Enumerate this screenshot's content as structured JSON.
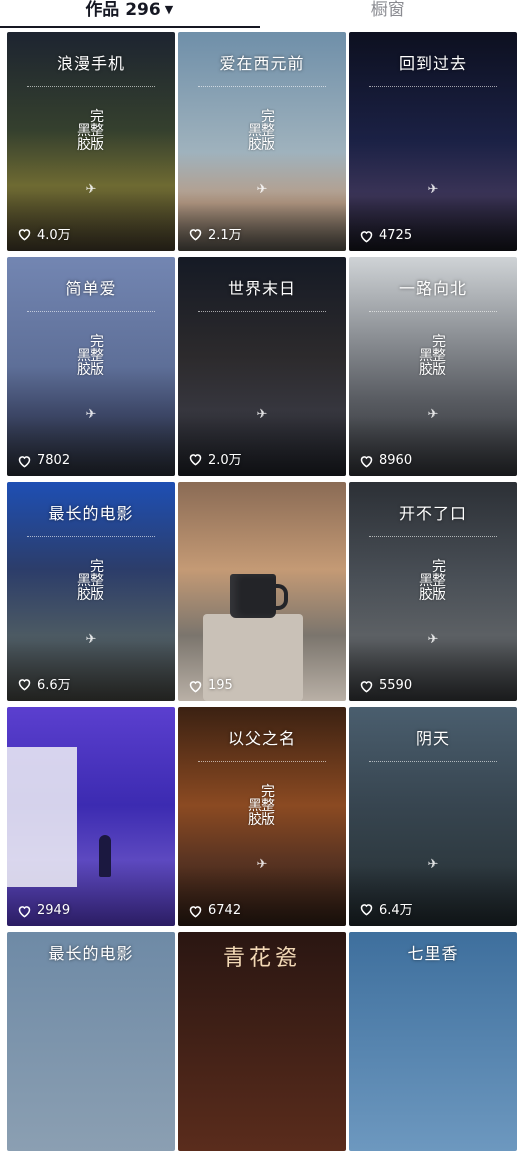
{
  "tabs": {
    "works_label": "作品 296",
    "favorites_label": "橱窗"
  },
  "posts": [
    {
      "title": "浪漫手机",
      "likes": "4.0万",
      "badge": true
    },
    {
      "title": "爱在西元前",
      "likes": "2.1万",
      "badge": true
    },
    {
      "title": "回到过去",
      "likes": "4725",
      "badge": false
    },
    {
      "title": "简单爱",
      "likes": "7802",
      "badge": true
    },
    {
      "title": "世界末日",
      "likes": "2.0万",
      "badge": false
    },
    {
      "title": "一路向北",
      "likes": "8960",
      "badge": true
    },
    {
      "title": "最长的电影",
      "likes": "6.6万",
      "badge": true
    },
    {
      "title": "",
      "likes": "195",
      "badge": false
    },
    {
      "title": "开不了口",
      "likes": "5590",
      "badge": true
    },
    {
      "title": "",
      "likes": "2949",
      "badge": false
    },
    {
      "title": "以父之名",
      "likes": "6742",
      "badge": true
    },
    {
      "title": "阴天",
      "likes": "6.4万",
      "badge": false
    },
    {
      "title": "最长的电影",
      "likes": "",
      "badge": false
    },
    {
      "title": "青花瓷",
      "likes": "",
      "badge": false
    },
    {
      "title": "七里香",
      "likes": "",
      "badge": false
    }
  ],
  "badge_text": {
    "left": "黑胶",
    "right": "完整版"
  },
  "icons": {
    "like": "heart-outline-icon",
    "share": "paper-plane-icon",
    "caret": "caret-down-icon"
  },
  "colors": {
    "active_tab": "#161823",
    "inactive_tab": "#8a8b91",
    "background": "#ffffff"
  }
}
